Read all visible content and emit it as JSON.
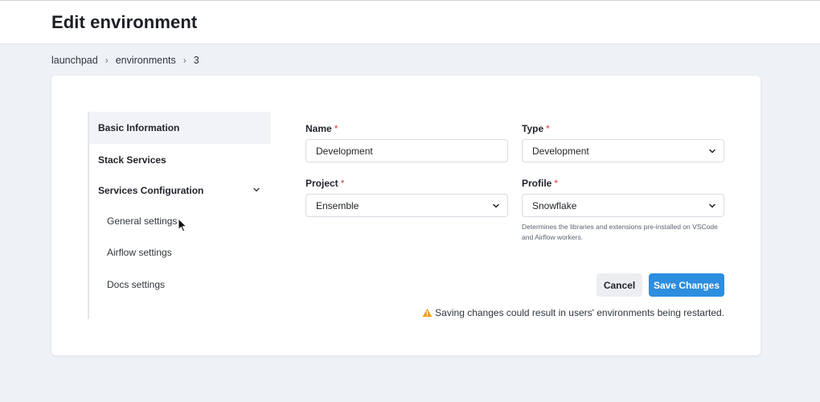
{
  "header": {
    "title": "Edit environment"
  },
  "breadcrumb": {
    "items": [
      "launchpad",
      "environments",
      "3"
    ],
    "separator": "›"
  },
  "sidebar": {
    "items": [
      {
        "label": "Basic Information"
      },
      {
        "label": "Stack Services"
      },
      {
        "label": "Services Configuration"
      }
    ],
    "subitems": [
      {
        "label": "General settings"
      },
      {
        "label": "Airflow settings"
      },
      {
        "label": "Docs settings"
      }
    ]
  },
  "form": {
    "name": {
      "label": "Name",
      "required_mark": "*",
      "value": "Development"
    },
    "type": {
      "label": "Type",
      "required_mark": "*",
      "value": "Development"
    },
    "project": {
      "label": "Project",
      "required_mark": "*",
      "value": "Ensemble"
    },
    "profile": {
      "label": "Profile",
      "required_mark": "*",
      "value": "Snowflake",
      "help": "Determines the libraries and extensions pre-installed on VSCode and Airflow workers."
    }
  },
  "actions": {
    "cancel_label": "Cancel",
    "save_label": "Save Changes"
  },
  "warning": {
    "text": "Saving changes could result in users' environments being restarted."
  },
  "colors": {
    "accent": "#2d8ddf",
    "required": "#d33a3a",
    "warning": "#f0a020",
    "background": "#eef1f6"
  },
  "icons": {
    "sidebar_chevron": "chevron-down-icon",
    "select_caret": "chevron-down-icon",
    "warning": "warning-icon",
    "cursor": "mouse-pointer-icon"
  }
}
